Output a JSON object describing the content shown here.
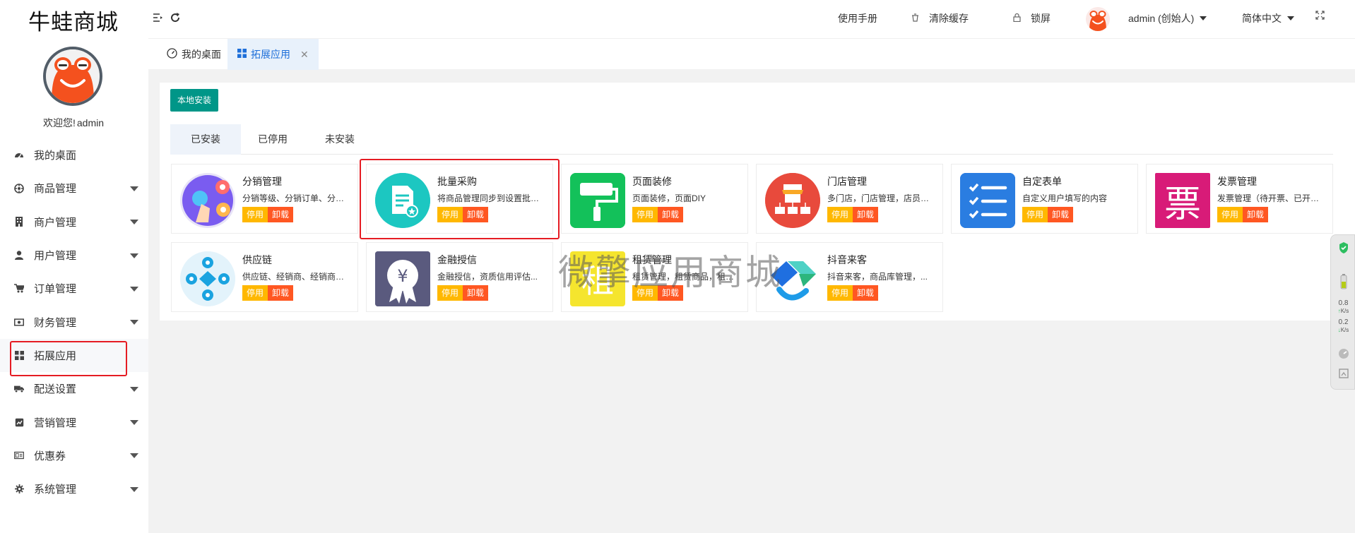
{
  "brand": "牛蛙商城",
  "welcome": {
    "prefix": "欢迎您!",
    "user": "admin"
  },
  "sidebar": {
    "items": [
      {
        "label": "我的桌面",
        "icon": "dashboard-icon",
        "caret": false
      },
      {
        "label": "商品管理",
        "icon": "gear-cog-icon",
        "caret": true
      },
      {
        "label": "商户管理",
        "icon": "building-icon",
        "caret": true
      },
      {
        "label": "用户管理",
        "icon": "user-icon",
        "caret": true
      },
      {
        "label": "订单管理",
        "icon": "cart-icon",
        "caret": true
      },
      {
        "label": "财务管理",
        "icon": "money-icon",
        "caret": true
      },
      {
        "label": "拓展应用",
        "icon": "grid-icon",
        "caret": false
      },
      {
        "label": "配送设置",
        "icon": "truck-icon",
        "caret": true
      },
      {
        "label": "营销管理",
        "icon": "chart-icon",
        "caret": true
      },
      {
        "label": "优惠券",
        "icon": "ticket-icon",
        "caret": true
      },
      {
        "label": "系统管理",
        "icon": "settings-icon",
        "caret": true
      }
    ]
  },
  "header": {
    "manual": "使用手册",
    "clear_cache": "清除缓存",
    "lock": "锁屏",
    "user": "admin (创始人)",
    "language": "简体中文"
  },
  "tabs": [
    {
      "label": "我的桌面"
    },
    {
      "label": "拓展应用"
    }
  ],
  "install_button": "本地安装",
  "sub_tabs": [
    "已安装",
    "已停用",
    "未安装"
  ],
  "apps": [
    {
      "title": "分销管理",
      "desc": "分销等级、分销订单、分销商..."
    },
    {
      "title": "批量采购",
      "desc": "将商品管理同步到设置批发价..."
    },
    {
      "title": "页面装修",
      "desc": "页面装修，页面DIY"
    },
    {
      "title": "门店管理",
      "desc": "多门店，门店管理，店员管理..."
    },
    {
      "title": "自定表单",
      "desc": "自定义用户填写的内容"
    },
    {
      "title": "发票管理",
      "desc": "发票管理（待开票、已开票）..."
    },
    {
      "title": "供应链",
      "desc": "供应链、经销商、经销商品..."
    },
    {
      "title": "金融授信",
      "desc": "金融授信，资质信用评估..."
    },
    {
      "title": "租赁管理",
      "desc": "租赁管理，租赁商品，租赁订单..."
    },
    {
      "title": "抖音来客",
      "desc": "抖音来客，商品库管理，..."
    }
  ],
  "app_buttons": {
    "stop": "停用",
    "uninstall": "卸载"
  },
  "watermark": "微擎应用商城",
  "float_widget": {
    "up": "0.8",
    "down": "0.2",
    "unit": "K/s"
  },
  "colors": {
    "install_button": "#009688",
    "stop_button": "#ffb800",
    "uninstall_button": "#ff5722",
    "highlight": "#e51c23",
    "tab_active": "#1e6fd9"
  }
}
